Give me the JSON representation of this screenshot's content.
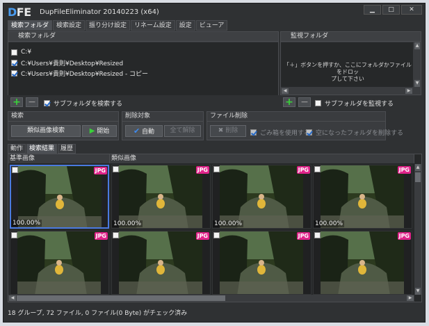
{
  "window": {
    "logo": {
      "d": "D",
      "f": "F",
      "e": "E"
    },
    "title": "DupFileEliminator 20140223 (x64)",
    "controls": {
      "minimize": "▁",
      "maximize": "□",
      "close": "✕"
    }
  },
  "menu_tabs": [
    "検索フォルダ",
    "検索設定",
    "振り分け設定",
    "リネーム設定",
    "設定",
    "ビューア"
  ],
  "search_folders": {
    "header": "検索フォルダ",
    "items": [
      {
        "path": "C:¥",
        "checked": false
      },
      {
        "path": "C:¥Users¥貴則¥Desktop¥Resized",
        "checked": true
      },
      {
        "path": "C:¥Users¥貴則¥Desktop¥Resized - コピー",
        "checked": true
      }
    ],
    "subfolder_label": "サブフォルダを検索する"
  },
  "watch_folders": {
    "header": "監視フォルダ",
    "hint_line1": "「＋」ボタンを押すか、ここにフォルダかファイルをドロッ",
    "hint_line2": "プして下さい",
    "subfolder_label": "サブフォルダを監視する"
  },
  "search_group": {
    "header": "検索",
    "similar_button": "類似画像検索",
    "start_button": "開始"
  },
  "delete_target_group": {
    "header": "削除対象",
    "auto_button": "自動",
    "clear_all_button": "全て解除"
  },
  "file_delete_group": {
    "header": "ファイル削除",
    "delete_button": "削除",
    "recycle_label": "ごみ箱を使用する",
    "empty_folder_label": "空になったフォルダを削除する"
  },
  "lower_tabs": [
    "動作",
    "検索結果",
    "履歴"
  ],
  "results": {
    "col_base": "基準画像",
    "col_similar": "類似画像",
    "badge": "JPG",
    "row1": [
      "100.00%",
      "100.00%",
      "100.00%",
      "100.00%"
    ],
    "row2": [
      "",
      "",
      "",
      ""
    ]
  },
  "status_text": "18 グループ, 72 ファイル, 0 ファイル(0 Byte) がチェック済み",
  "colors": {
    "accent": "#4a7ae0",
    "badge": "#e0248a",
    "plus": "#3ad13a",
    "bg": "#2f3133"
  }
}
